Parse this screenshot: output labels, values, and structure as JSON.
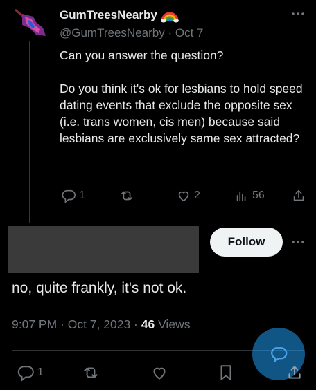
{
  "original_tweet": {
    "display_name": "GumTreesNearby",
    "handle": "@GumTreesNearby",
    "separator": "·",
    "date": "Oct 7",
    "text": "Can you answer the question?\n\nDo you think it's ok for lesbians to hold speed dating events that exclude the opposite sex (i.e. trans women, cis men) because said lesbians are exclusively same sex attracted?",
    "reply_count": "1",
    "like_count": "2",
    "view_count": "56"
  },
  "reply": {
    "follow_label": "Follow",
    "text": "no, quite frankly, it's not ok.",
    "time": "9:07 PM · Oct 7, 2023 · ",
    "views_count": "46",
    "views_label": " Views",
    "reply_count": "1"
  },
  "icons": {
    "avatar": "lesbian-flag-avatar",
    "emoji": "rainbow-icon",
    "more": "ellipsis-icon",
    "reply": "speech-bubble-icon",
    "retweet": "retweet-icon",
    "like": "heart-icon",
    "views": "bar-chart-icon",
    "share": "share-icon",
    "bookmark": "bookmark-icon",
    "fab": "compose-icon"
  },
  "colors": {
    "background": "#000000",
    "text_primary": "#e7e9ea",
    "text_secondary": "#71767b",
    "accent": "#1d9bf0"
  }
}
